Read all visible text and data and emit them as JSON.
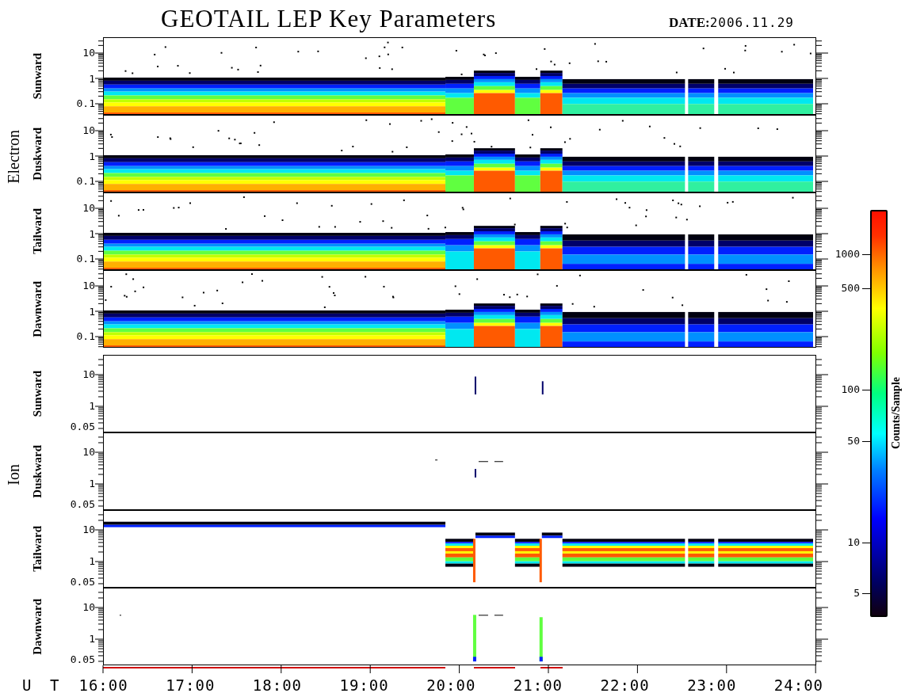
{
  "title": "GEOTAIL LEP Key Parameters",
  "date": {
    "label": "DATE:",
    "value": "2006.11.29"
  },
  "groups": [
    {
      "name": "Electron",
      "panels": [
        {
          "label": "Sunward",
          "kind": "electron-warm",
          "yticks": [
            "10",
            "1",
            "0.1"
          ]
        },
        {
          "label": "Duskward",
          "kind": "electron-warm",
          "yticks": [
            "10",
            "1",
            "0.1"
          ]
        },
        {
          "label": "Tailward",
          "kind": "electron-cool",
          "yticks": [
            "10",
            "1",
            "0.1"
          ]
        },
        {
          "label": "Dawnward",
          "kind": "electron-cool",
          "yticks": [
            "10",
            "1",
            "0.1"
          ]
        }
      ]
    },
    {
      "name": "Ion",
      "panels": [
        {
          "label": "Sunward",
          "kind": "ion-spikes",
          "yticks": [
            "10",
            "1",
            "0.05"
          ]
        },
        {
          "label": "Duskward",
          "kind": "ion-faint",
          "yticks": [
            "10",
            "1",
            "0.05"
          ]
        },
        {
          "label": "Tailward",
          "kind": "ion-bands",
          "yticks": [
            "10",
            "1",
            "0.05"
          ]
        },
        {
          "label": "Dawnward",
          "kind": "ion-bars",
          "yticks": [
            "10",
            "1",
            "0.05"
          ]
        }
      ]
    }
  ],
  "x_axis": {
    "label": "U T",
    "ticks": [
      "16:00",
      "17:00",
      "18:00",
      "19:00",
      "20:00",
      "21:00",
      "22:00",
      "23:00",
      "24:00"
    ]
  },
  "colorbar": {
    "title": "Counts/Sample",
    "ticks": [
      "1000",
      "500",
      "100",
      "50",
      "10",
      "5"
    ]
  }
}
